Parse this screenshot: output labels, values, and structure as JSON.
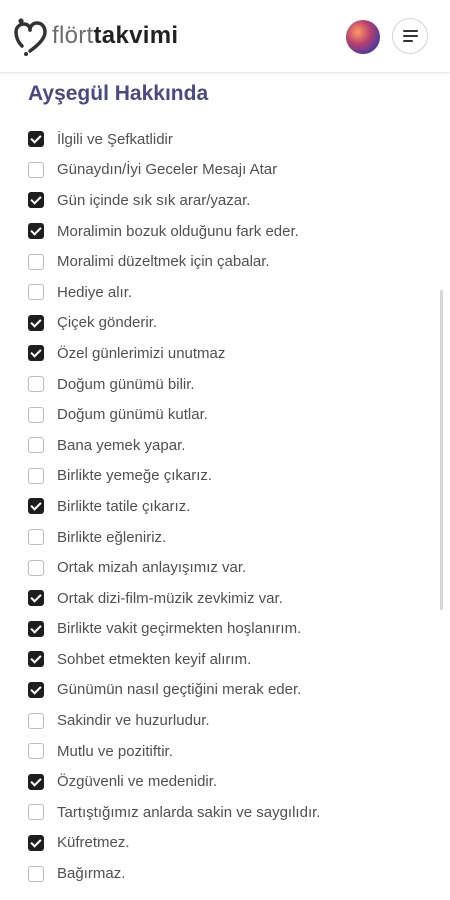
{
  "header": {
    "logo_part1": "flört",
    "logo_part2": "takvimi"
  },
  "section": {
    "title": "Ayşegül Hakkında"
  },
  "items": [
    {
      "label": "İlgili ve Şefkatlidir",
      "checked": true
    },
    {
      "label": "Günaydın/İyi Geceler Mesajı Atar",
      "checked": false
    },
    {
      "label": "Gün içinde sık sık arar/yazar.",
      "checked": true
    },
    {
      "label": "Moralimin bozuk olduğunu fark eder.",
      "checked": true
    },
    {
      "label": "Moralimi düzeltmek için çabalar.",
      "checked": false
    },
    {
      "label": "Hediye alır.",
      "checked": false
    },
    {
      "label": "Çiçek gönderir.",
      "checked": true
    },
    {
      "label": "Özel günlerimizi unutmaz",
      "checked": true
    },
    {
      "label": "Doğum günümü bilir.",
      "checked": false
    },
    {
      "label": "Doğum günümü kutlar.",
      "checked": false
    },
    {
      "label": "Bana yemek yapar.",
      "checked": false
    },
    {
      "label": "Birlikte yemeğe çıkarız.",
      "checked": false
    },
    {
      "label": "Birlikte tatile çıkarız.",
      "checked": true
    },
    {
      "label": "Birlikte eğleniriz.",
      "checked": false
    },
    {
      "label": "Ortak mizah anlayışımız var.",
      "checked": false
    },
    {
      "label": "Ortak dizi-film-müzik zevkimiz var.",
      "checked": true
    },
    {
      "label": "Birlikte vakit geçirmekten hoşlanırım.",
      "checked": true
    },
    {
      "label": "Sohbet etmekten keyif alırım.",
      "checked": true
    },
    {
      "label": "Günümün nasıl geçtiğini merak eder.",
      "checked": true
    },
    {
      "label": "Sakindir ve huzurludur.",
      "checked": false
    },
    {
      "label": "Mutlu ve pozitiftir.",
      "checked": false
    },
    {
      "label": "Özgüvenli ve medenidir.",
      "checked": true
    },
    {
      "label": "Tartıştığımız anlarda sakin ve saygılıdır.",
      "checked": false
    },
    {
      "label": "Küfretmez.",
      "checked": true
    },
    {
      "label": "Bağırmaz.",
      "checked": false
    }
  ],
  "colors": {
    "accent_title": "#4a4a82",
    "checkbox_checked": "#1e1e1e"
  },
  "icons": {
    "logo": "heart-logo-icon",
    "menu": "hamburger-menu-icon"
  }
}
